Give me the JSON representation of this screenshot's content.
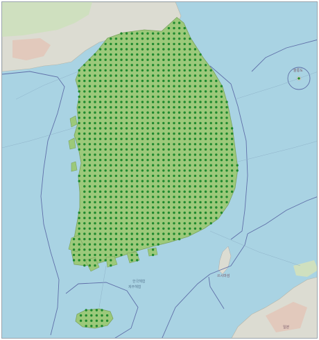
{
  "map": {
    "colors": {
      "sea": "#a9d3e3",
      "land": "#dcdcd2",
      "green_overlay": "#9cc97a",
      "dot": "#1f8a2e",
      "urban": "#d9b9a8",
      "boundary": "#5f6fa8"
    },
    "grid_marker": {
      "color": "#1f8a2e",
      "shape": "circle"
    },
    "labels": {
      "south_sea": "한국해협",
      "jeju_strait": "제주해협",
      "tsushima": "쓰시마섬",
      "ulleung": "울릉도",
      "mainland_jp": "일본"
    }
  }
}
